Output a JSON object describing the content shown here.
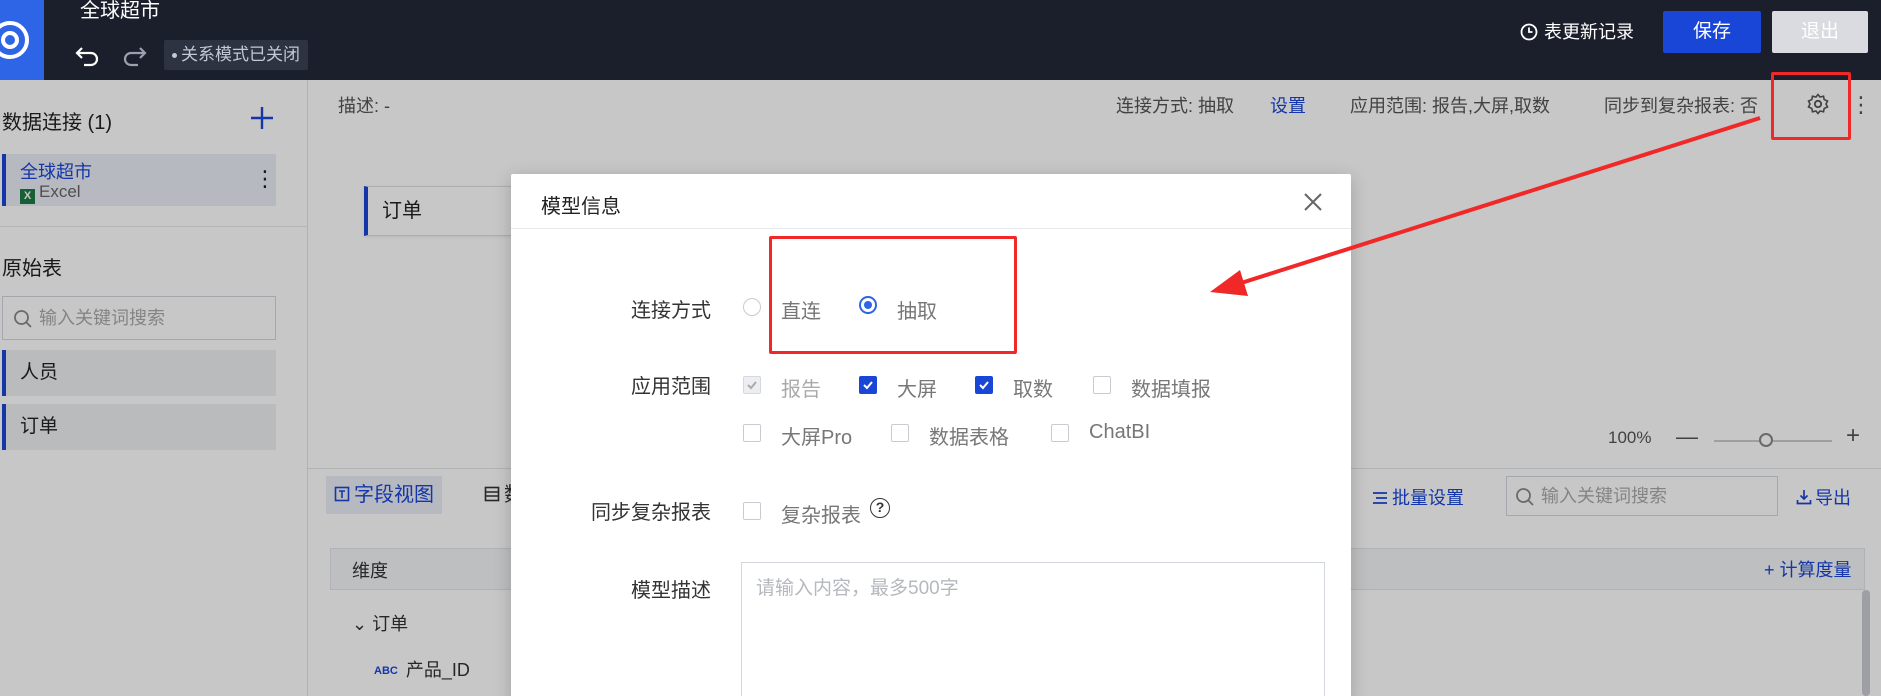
{
  "header": {
    "app_title": "全球超市",
    "relation_mode": "关系模式已关闭",
    "update_log": "表更新记录",
    "save": "保存",
    "exit": "退出"
  },
  "sidebar": {
    "connections_title": "数据连接 (1)",
    "connection": {
      "name": "全球超市",
      "type": "Excel"
    },
    "raw_tables_title": "原始表",
    "search_placeholder": "输入关键词搜索",
    "tables": [
      "人员",
      "订单"
    ]
  },
  "canvas": {
    "description": "描述: -",
    "connect_mode": "连接方式: 抽取",
    "settings_link": "设置",
    "apply_scope": "应用范围: 报告,大屏,取数",
    "sync_complex": "同步到复杂报表: 否",
    "node_order": "订单",
    "zoom": "100%"
  },
  "bottom": {
    "tab_fields": "字段视图",
    "tab_data_partial": "数",
    "batch_settings": "批量设置",
    "search_placeholder": "输入关键词搜索",
    "export": "导出",
    "dimension": "维度",
    "calc_measure": "计算度量",
    "tree_group": "订单",
    "field": "产品_ID",
    "field_type": "ABC"
  },
  "modal": {
    "title": "模型信息",
    "connect_label": "连接方式",
    "connect_options": [
      {
        "label": "直连",
        "selected": false
      },
      {
        "label": "抽取",
        "selected": true
      }
    ],
    "scope_label": "应用范围",
    "scope_options": [
      {
        "label": "报告",
        "checked": true,
        "disabled": true
      },
      {
        "label": "大屏",
        "checked": true,
        "disabled": false
      },
      {
        "label": "取数",
        "checked": true,
        "disabled": false
      },
      {
        "label": "数据填报",
        "checked": false,
        "disabled": false
      },
      {
        "label": "大屏Pro",
        "checked": false,
        "disabled": false
      },
      {
        "label": "数据表格",
        "checked": false,
        "disabled": false
      },
      {
        "label": "ChatBI",
        "checked": false,
        "disabled": false
      }
    ],
    "sync_label": "同步复杂报表",
    "sync_option": "复杂报表",
    "help": "?",
    "desc_label": "模型描述",
    "desc_placeholder": "请输入内容，最多500字"
  },
  "colors": {
    "accent": "#1a46d8",
    "topbar": "#1b1f2b",
    "annotation": "#f02828"
  }
}
